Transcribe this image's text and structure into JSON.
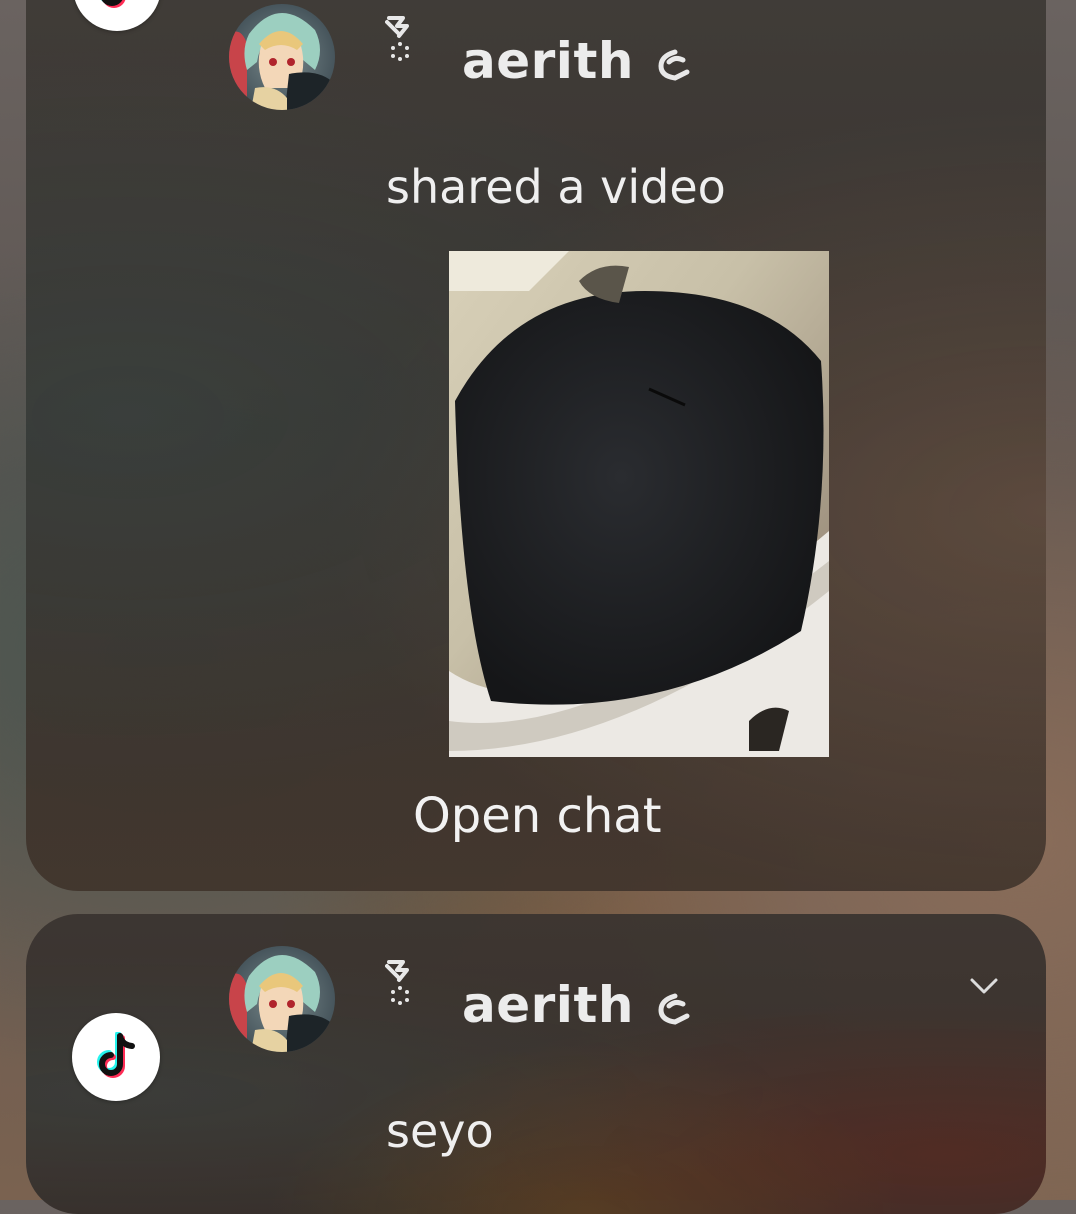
{
  "colors": {
    "text_primary": "#ececec",
    "icon_background": "#ffffff",
    "tiktok_cyan": "#25f4ee",
    "tiktok_red": "#fe2c55",
    "tiktok_black": "#111111"
  },
  "notifications": [
    {
      "app_icon": "tiktok-icon",
      "avatar": "anime-avatar",
      "sender": "aerith",
      "message": "shared a video",
      "attachment": "video-thumbnail",
      "action_label": "Open chat"
    },
    {
      "app_icon": "tiktok-icon",
      "avatar": "anime-avatar",
      "sender": "aerith",
      "message": "seyo",
      "expand_icon": "chevron-down-icon"
    }
  ]
}
